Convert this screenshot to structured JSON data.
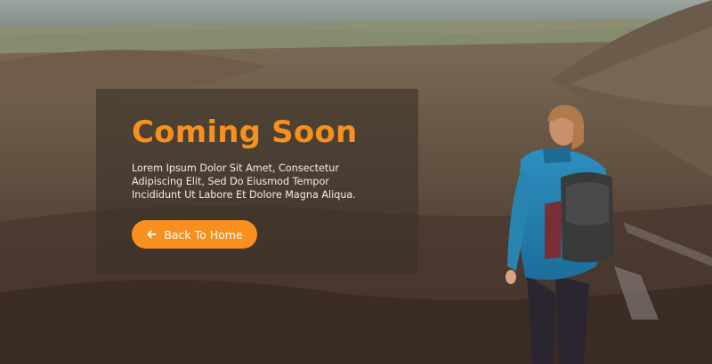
{
  "hero": {
    "title": "Coming Soon",
    "description": "Lorem Ipsum Dolor Sit Amet, Consectetur Adipiscing Elit, Sed Do Eiusmod Tempor Incididunt Ut Labore Et Dolore Magna Aliqua.",
    "button_label": "Back To Home",
    "button_icon": "arrow-left-icon",
    "background_image": "hiker-mountain-valley-photo"
  },
  "colors": {
    "accent": "#f7901e",
    "card_overlay": "rgba(60,50,40,0.62)",
    "text_light": "#f3eee8"
  }
}
